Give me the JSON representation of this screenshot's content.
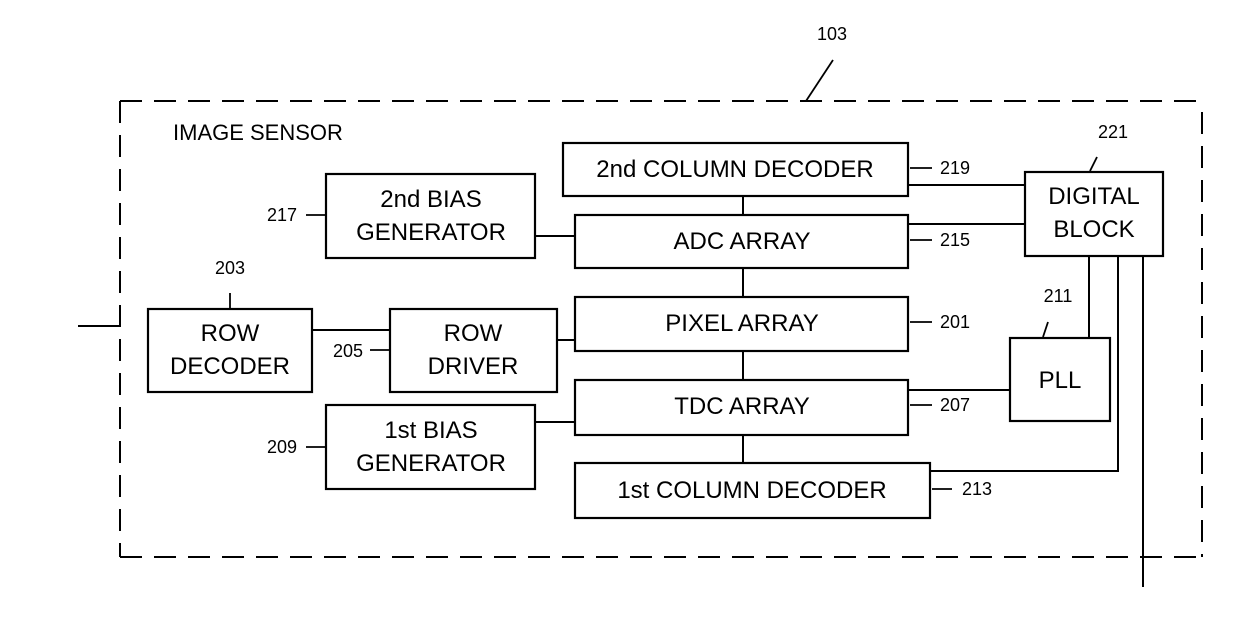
{
  "diagram": {
    "frame": {
      "ref": "103",
      "title": "IMAGE SENSOR"
    },
    "blocks": {
      "col_decoder_2": {
        "label": "2nd COLUMN DECODER",
        "ref": "219"
      },
      "bias_gen_2": {
        "line1": "2nd BIAS",
        "line2": "GENERATOR",
        "ref": "217"
      },
      "adc_array": {
        "label": "ADC ARRAY",
        "ref": "215"
      },
      "digital_block": {
        "line1": "DIGITAL",
        "line2": "BLOCK",
        "ref": "221"
      },
      "row_decoder": {
        "line1": "ROW",
        "line2": "DECODER",
        "ref": "203"
      },
      "row_driver": {
        "line1": "ROW",
        "line2": "DRIVER",
        "ref": "205"
      },
      "pixel_array": {
        "label": "PIXEL ARRAY",
        "ref": "201"
      },
      "pll": {
        "label": "PLL",
        "ref": "211"
      },
      "tdc_array": {
        "label": "TDC ARRAY",
        "ref": "207"
      },
      "bias_gen_1": {
        "line1": "1st BIAS",
        "line2": "GENERATOR",
        "ref": "209"
      },
      "col_decoder_1": {
        "label": "1st COLUMN DECODER",
        "ref": "213"
      }
    }
  }
}
